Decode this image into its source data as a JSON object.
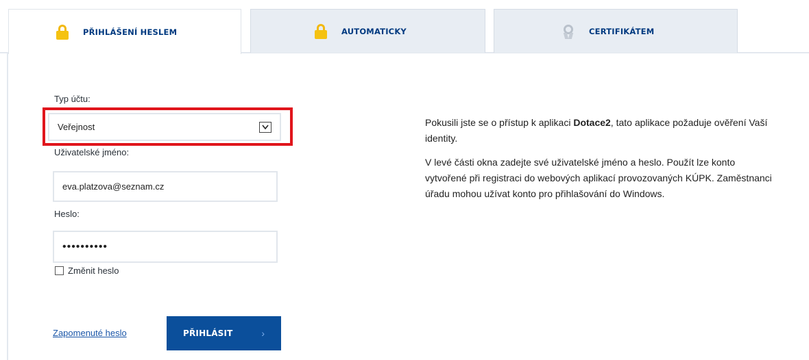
{
  "tabs": [
    {
      "label": "PŘIHLÁŠENÍ HESLEM",
      "icon": "lock-icon",
      "active": true
    },
    {
      "label": "AUTOMATICKY",
      "icon": "lock-icon",
      "active": false
    },
    {
      "label": "CERTIFIKÁTEM",
      "icon": "certificate-icon",
      "active": false
    }
  ],
  "form": {
    "account_type_label": "Typ účtu:",
    "account_type_value": "Veřejnost",
    "username_label": "Uživatelské jméno:",
    "username_value": "eva.platzova@seznam.cz",
    "password_label": "Heslo:",
    "password_value": "••••••••••",
    "change_password_label": "Změnit heslo",
    "forgot_link": "Zapomenuté heslo",
    "login_button": "PŘIHLÁSIT",
    "login_arrow": "›"
  },
  "info": {
    "p1_before": "Pokusili jste se o přístup k aplikaci ",
    "p1_app": "Dotace2",
    "p1_after": ", tato aplikace požaduje ověření Vaší identity.",
    "p2": "V levé části okna zadejte své uživatelské jméno a heslo. Použít lze konto vytvořené při registraci do webových aplikací provozovaných KÚPK. Zaměstnanci úřadu mohou užívat konto pro přihlašování do Windows."
  },
  "colors": {
    "accent": "#0b4f9b",
    "tab_text": "#003a80",
    "highlight": "#e0151c",
    "lock": "#f5c211"
  }
}
